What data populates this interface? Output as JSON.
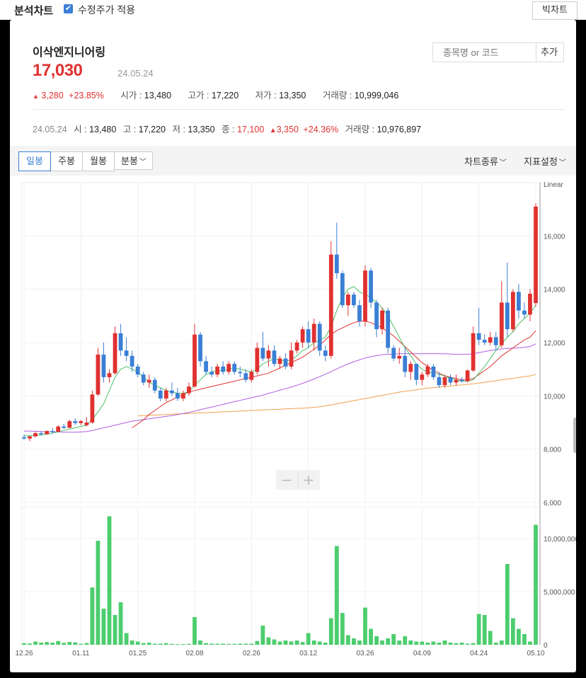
{
  "header": {
    "title": "분석차트",
    "adjust_label": "수정주가 적용",
    "chart_button": "빅차트"
  },
  "stock": {
    "name": "이삭엔지니어링",
    "price": "17,030",
    "date": "24.05.24",
    "change": "3,280",
    "change_pct": "+23.85%",
    "open_label": "시가 :",
    "open": "13,480",
    "high_label": "고가 :",
    "high": "17,220",
    "low_label": "저가 :",
    "low": "13,350",
    "vol_label": "거래량 :",
    "volume": "10,999,046"
  },
  "search": {
    "placeholder": "종목명 or 코드",
    "add_label": "추가"
  },
  "daily": {
    "date": "24.05.24",
    "o_label": "시 :",
    "o": "13,480",
    "h_label": "고 :",
    "h": "17,220",
    "l_label": "저 :",
    "l": "13,350",
    "c_label": "종 :",
    "c": "17,100",
    "chg": "3,350",
    "chg_pct": "+24.36%",
    "v_label": "거래량 :",
    "v": "10,976,897"
  },
  "tabs": [
    "일봉",
    "주봉",
    "월봉",
    "분봉"
  ],
  "dropdowns": [
    "차트종류",
    "지표설정"
  ],
  "colors": {
    "up": "#e03131",
    "down": "#3a7fd5",
    "volume": "#4ccd6e",
    "ma5": "#4cc26a",
    "ma20": "#e03131",
    "ma60": "#b05ee0",
    "ma120": "#f0a050"
  },
  "chart_data": {
    "type": "candlestick",
    "scale_label": "Linear",
    "yticks": [
      6000,
      8000,
      10000,
      12000,
      14000,
      16000
    ],
    "ytick_labels": [
      "6,000",
      "8,000",
      "10,000",
      "12,000",
      "14,000",
      "16,000"
    ],
    "ylim": [
      6000,
      18000
    ],
    "vol_ticks": [
      0,
      5000000,
      10000000
    ],
    "vol_tick_labels": [
      "0",
      "5,000,000",
      "10,000,000"
    ],
    "vol_ylim": [
      0,
      13000000
    ],
    "xtick_labels": [
      "12.26",
      "01.11",
      "01.25",
      "02.08",
      "02.26",
      "03.12",
      "03.26",
      "04.09",
      "04.24",
      "05.10"
    ],
    "xtick_index": [
      0,
      10,
      20,
      30,
      40,
      50,
      60,
      70,
      80,
      90
    ],
    "ohlc": [
      [
        8450,
        8550,
        8350,
        8400
      ],
      [
        8400,
        8500,
        8300,
        8480
      ],
      [
        8480,
        8650,
        8450,
        8600
      ],
      [
        8600,
        8650,
        8500,
        8560
      ],
      [
        8560,
        8700,
        8550,
        8680
      ],
      [
        8680,
        8800,
        8600,
        8650
      ],
      [
        8650,
        8900,
        8650,
        8850
      ],
      [
        8850,
        8950,
        8750,
        8800
      ],
      [
        8800,
        9100,
        8800,
        9050
      ],
      [
        9050,
        9150,
        8900,
        8980
      ],
      [
        8980,
        9100,
        8900,
        9050
      ],
      [
        8900,
        9200,
        8850,
        9000
      ],
      [
        9000,
        10200,
        8950,
        10050
      ],
      [
        10050,
        11800,
        10000,
        11550
      ],
      [
        11550,
        12000,
        10500,
        10700
      ],
      [
        10700,
        11000,
        10500,
        10850
      ],
      [
        10850,
        12600,
        10800,
        12350
      ],
      [
        12350,
        12700,
        11500,
        11700
      ],
      [
        11700,
        12200,
        11300,
        11500
      ],
      [
        11500,
        11700,
        10900,
        11100
      ],
      [
        11100,
        11200,
        10700,
        10800
      ],
      [
        10800,
        10900,
        10400,
        10500
      ],
      [
        10500,
        10800,
        10300,
        10600
      ],
      [
        10600,
        10700,
        10100,
        10200
      ],
      [
        10200,
        10300,
        9800,
        9900
      ],
      [
        9900,
        10300,
        9800,
        10200
      ],
      [
        10200,
        10500,
        10000,
        10100
      ],
      [
        10100,
        10300,
        9800,
        9900
      ],
      [
        9900,
        10200,
        9800,
        10100
      ],
      [
        10100,
        10500,
        10000,
        10350
      ],
      [
        10350,
        12700,
        10300,
        12300
      ],
      [
        12300,
        12400,
        11100,
        11300
      ],
      [
        11300,
        11500,
        10800,
        10900
      ],
      [
        10900,
        11100,
        10700,
        10800
      ],
      [
        10800,
        11200,
        10700,
        11100
      ],
      [
        11100,
        11300,
        10800,
        10900
      ],
      [
        10900,
        11300,
        10800,
        11200
      ],
      [
        11200,
        11300,
        10800,
        10900
      ],
      [
        10900,
        11100,
        10700,
        10850
      ],
      [
        10850,
        11000,
        10500,
        10600
      ],
      [
        10600,
        11000,
        10500,
        10900
      ],
      [
        10900,
        12000,
        10800,
        11800
      ],
      [
        11800,
        12400,
        11300,
        11400
      ],
      [
        11400,
        11900,
        11100,
        11700
      ],
      [
        11700,
        11900,
        11100,
        11200
      ],
      [
        11200,
        11500,
        11000,
        11400
      ],
      [
        11400,
        11600,
        11000,
        11100
      ],
      [
        11100,
        12000,
        11000,
        11700
      ],
      [
        11700,
        12100,
        11600,
        12000
      ],
      [
        12000,
        12600,
        11800,
        12500
      ],
      [
        12500,
        12800,
        11800,
        12000
      ],
      [
        12000,
        12900,
        11700,
        12700
      ],
      [
        12700,
        12800,
        11500,
        11700
      ],
      [
        11700,
        11900,
        11300,
        11500
      ],
      [
        11500,
        15800,
        11400,
        15300
      ],
      [
        15300,
        16500,
        14400,
        14600
      ],
      [
        14600,
        14700,
        13300,
        13400
      ],
      [
        13400,
        13900,
        13000,
        13800
      ],
      [
        13800,
        13900,
        13300,
        13400
      ],
      [
        13400,
        13600,
        12600,
        12800
      ],
      [
        12800,
        14900,
        12600,
        14700
      ],
      [
        14700,
        14800,
        13300,
        13500
      ],
      [
        13500,
        13600,
        12200,
        12500
      ],
      [
        12500,
        13300,
        12300,
        13200
      ],
      [
        13200,
        13300,
        11600,
        11800
      ],
      [
        11800,
        11900,
        11300,
        11400
      ],
      [
        11400,
        11800,
        11200,
        11500
      ],
      [
        11500,
        11800,
        10700,
        10900
      ],
      [
        10900,
        11300,
        10600,
        11200
      ],
      [
        11200,
        11200,
        10400,
        10600
      ],
      [
        10600,
        10900,
        10400,
        10800
      ],
      [
        10800,
        11200,
        10700,
        11100
      ],
      [
        11100,
        11200,
        10600,
        10700
      ],
      [
        10700,
        10900,
        10300,
        10400
      ],
      [
        10400,
        10800,
        10300,
        10700
      ],
      [
        10700,
        10800,
        10400,
        10500
      ],
      [
        10500,
        10800,
        10400,
        10600
      ],
      [
        10600,
        10700,
        10500,
        10550
      ],
      [
        10550,
        11000,
        10500,
        10950
      ],
      [
        10950,
        12600,
        10900,
        12350
      ],
      [
        12350,
        13300,
        11900,
        12100
      ],
      [
        12100,
        12300,
        11900,
        12000
      ],
      [
        12000,
        12400,
        11900,
        12200
      ],
      [
        12200,
        12400,
        11700,
        11900
      ],
      [
        11900,
        14300,
        11800,
        13500
      ],
      [
        13500,
        15000,
        12200,
        12500
      ],
      [
        12500,
        14000,
        12400,
        13900
      ],
      [
        13900,
        14200,
        12900,
        13200
      ],
      [
        13200,
        13500,
        12900,
        13050
      ],
      [
        13050,
        14000,
        12800,
        13830
      ],
      [
        13480,
        17220,
        13350,
        17100
      ]
    ],
    "volume": [
      150000,
      120000,
      300000,
      200000,
      260000,
      200000,
      350000,
      180000,
      260000,
      220000,
      90000,
      160000,
      5400000,
      9800000,
      3400000,
      12100000,
      2800000,
      4000000,
      1100000,
      400000,
      300000,
      150000,
      200000,
      100000,
      100000,
      150000,
      80000,
      50000,
      60000,
      80000,
      2600000,
      400000,
      150000,
      100000,
      100000,
      100000,
      80000,
      80000,
      100000,
      100000,
      100000,
      350000,
      1800000,
      700000,
      500000,
      300000,
      400000,
      300000,
      400000,
      250000,
      1100000,
      400000,
      300000,
      200000,
      2500000,
      9300000,
      3000000,
      900000,
      600000,
      400000,
      3500000,
      1500000,
      800000,
      400000,
      600000,
      1000000,
      400000,
      800000,
      400000,
      300000,
      300000,
      200000,
      300000,
      200000,
      400000,
      200000,
      150000,
      200000,
      100000,
      150000,
      2900000,
      2800000,
      1300000,
      200000,
      400000,
      7600000,
      2500000,
      1500000,
      1000000,
      300000,
      11300000
    ],
    "ma5": [
      8500,
      8500,
      8520,
      8540,
      8560,
      8600,
      8650,
      8700,
      8750,
      8800,
      8850,
      8900,
      9100,
      9400,
      9700,
      10200,
      10700,
      11000,
      11100,
      11000,
      10900,
      10700,
      10500,
      10400,
      10300,
      10200,
      10150,
      10100,
      10100,
      10150,
      10400,
      10600,
      10800,
      10900,
      10950,
      10950,
      11000,
      11050,
      11000,
      10950,
      10900,
      11000,
      11200,
      11300,
      11400,
      11350,
      11300,
      11350,
      11500,
      11700,
      11800,
      12000,
      12100,
      12200,
      12600,
      13200,
      13700,
      14000,
      14100,
      13900,
      13800,
      13700,
      13500,
      13300,
      13000,
      12600,
      12200,
      11800,
      11500,
      11200,
      11000,
      10900,
      10850,
      10800,
      10750,
      10650,
      10600,
      10550,
      10550,
      10600,
      10850,
      11100,
      11400,
      11700,
      11950,
      12200,
      12400,
      12700,
      12900,
      13100,
      13400
    ],
    "ma20": [
      null,
      null,
      null,
      null,
      null,
      null,
      null,
      null,
      null,
      null,
      null,
      null,
      null,
      null,
      null,
      null,
      null,
      null,
      null,
      8800,
      8950,
      9100,
      9300,
      9450,
      9600,
      9750,
      9850,
      9950,
      10050,
      10150,
      10200,
      10250,
      10300,
      10350,
      10400,
      10450,
      10500,
      10550,
      10600,
      10650,
      10700,
      10750,
      10800,
      10850,
      10950,
      11050,
      11150,
      11250,
      11350,
      11450,
      11600,
      11750,
      11900,
      12100,
      12300,
      12450,
      12550,
      12650,
      12750,
      12800,
      12800,
      12750,
      12650,
      12550,
      12400,
      12250,
      12050,
      11850,
      11650,
      11450,
      11250,
      11100,
      10950,
      10850,
      10750,
      10700,
      10650,
      10600,
      10600,
      10650,
      10800,
      10950,
      11100,
      11300,
      11500,
      11650,
      11800,
      11950,
      12100,
      12200,
      12450
    ],
    "ma60": [
      8680,
      8680,
      8670,
      8660,
      8650,
      8650,
      8650,
      8640,
      8640,
      8640,
      8650,
      8660,
      8700,
      8750,
      8800,
      8850,
      8900,
      8950,
      9000,
      9050,
      9080,
      9110,
      9140,
      9170,
      9200,
      9230,
      9260,
      9300,
      9340,
      9380,
      9430,
      9480,
      9530,
      9580,
      9630,
      9680,
      9730,
      9780,
      9830,
      9880,
      9930,
      9980,
      10030,
      10090,
      10150,
      10210,
      10270,
      10330,
      10400,
      10470,
      10550,
      10630,
      10720,
      10810,
      10910,
      11010,
      11110,
      11200,
      11280,
      11350,
      11420,
      11470,
      11510,
      11540,
      11560,
      11570,
      11580,
      11580,
      11580,
      11580,
      11580,
      11580,
      11580,
      11580,
      11580,
      11570,
      11560,
      11560,
      11560,
      11580,
      11620,
      11660,
      11700,
      11730,
      11760,
      11780,
      11790,
      11800,
      11820,
      11850,
      11950
    ],
    "ma120": [
      null,
      null,
      null,
      null,
      null,
      null,
      null,
      null,
      null,
      null,
      null,
      null,
      null,
      null,
      null,
      null,
      null,
      null,
      null,
      null,
      9250,
      9260,
      9270,
      9280,
      9290,
      9300,
      9310,
      9320,
      9330,
      9340,
      9350,
      9360,
      9370,
      9380,
      9390,
      9400,
      9410,
      9420,
      9430,
      9440,
      9450,
      9460,
      9470,
      9480,
      9490,
      9500,
      9510,
      9520,
      9530,
      9540,
      9550,
      9570,
      9590,
      9620,
      9660,
      9700,
      9740,
      9780,
      9820,
      9860,
      9900,
      9940,
      9980,
      10020,
      10060,
      10100,
      10140,
      10170,
      10200,
      10230,
      10260,
      10290,
      10310,
      10330,
      10350,
      10370,
      10390,
      10410,
      10430,
      10450,
      10480,
      10510,
      10540,
      10570,
      10600,
      10630,
      10660,
      10690,
      10720,
      10750,
      10800
    ]
  }
}
